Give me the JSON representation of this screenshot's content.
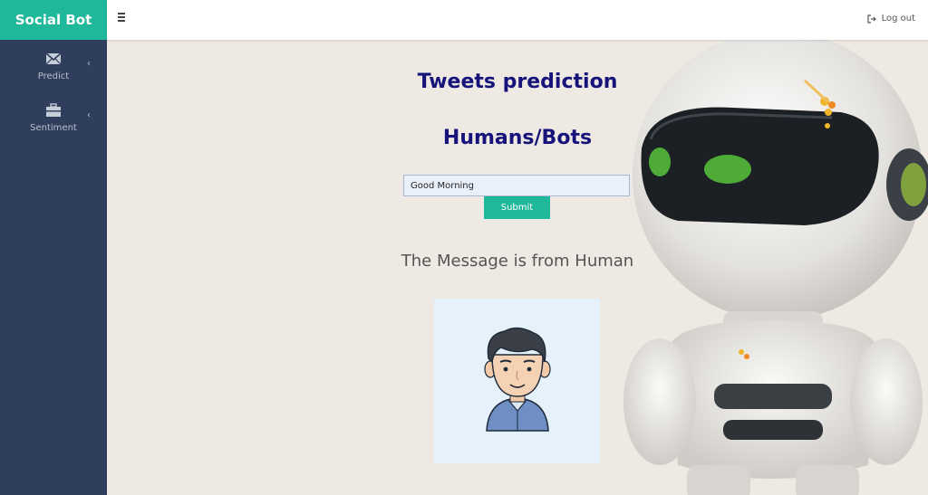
{
  "app": {
    "brand": "Social Bot"
  },
  "sidebar": {
    "items": [
      {
        "label": "Predict",
        "icon": "envelope-icon"
      },
      {
        "label": "Sentiment",
        "icon": "briefcase-icon"
      }
    ]
  },
  "topbar": {
    "logout_label": "Log out"
  },
  "main": {
    "title_line1": "Tweets prediction",
    "title_line2": "Humans/Bots",
    "input_value": "Good Morning",
    "submit_label": "Submit",
    "result_text": "The Message is from Human"
  },
  "colors": {
    "brand": "#1fb89a",
    "sidebar": "#2f3e5c",
    "title": "#16147a"
  }
}
